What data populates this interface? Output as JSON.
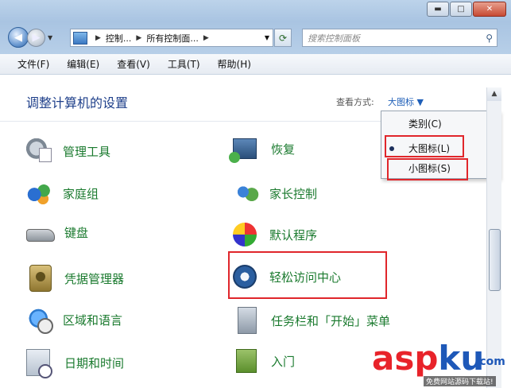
{
  "window": {
    "caption": {
      "minimize": "▬",
      "maximize": "□",
      "close": "✕"
    }
  },
  "nav": {
    "back": "◀",
    "forward": "▶",
    "dropdown": "▼"
  },
  "address": {
    "crumbs": [
      "控制...",
      "所有控制面..."
    ],
    "separator": "▶",
    "dropdown": "▼",
    "refresh": "⟳"
  },
  "search": {
    "placeholder": "搜索控制面板",
    "icon": "search-icon"
  },
  "menu": [
    "文件(F)",
    "编辑(E)",
    "查看(V)",
    "工具(T)",
    "帮助(H)"
  ],
  "content": {
    "heading": "调整计算机的设置",
    "view_by_label": "查看方式:",
    "view_by_value": "大图标 ▼"
  },
  "items_left": [
    {
      "label": "管理工具",
      "icon": "admin-tools-icon"
    },
    {
      "label": "家庭组",
      "icon": "homegroup-icon"
    },
    {
      "label": "键盘",
      "icon": "keyboard-icon"
    },
    {
      "label": "凭据管理器",
      "icon": "credential-manager-icon"
    },
    {
      "label": "区域和语言",
      "icon": "region-language-icon"
    },
    {
      "label": "日期和时间",
      "icon": "date-time-icon"
    }
  ],
  "items_right": [
    {
      "label": "恢复",
      "icon": "recovery-icon"
    },
    {
      "label": "家长控制",
      "icon": "parental-controls-icon"
    },
    {
      "label": "默认程序",
      "icon": "default-programs-icon"
    },
    {
      "label": "轻松访问中心",
      "icon": "ease-of-access-icon"
    },
    {
      "label": "任务栏和「开始」菜单",
      "icon": "taskbar-start-menu-icon"
    },
    {
      "label": "入门",
      "icon": "getting-started-icon"
    }
  ],
  "dropdown": {
    "options": [
      "类别(C)",
      "大图标(L)",
      "小图标(S)"
    ],
    "selected": "大图标(L)"
  },
  "scrollbar": {
    "up": "▲"
  },
  "watermark": {
    "brand_a": "asp",
    "brand_b": "ku",
    "domain": ".com",
    "tagline": "免费网站源码下载站!"
  },
  "colors": {
    "link_green": "#1a7a2e",
    "heading_blue": "#1e3f8a",
    "highlight_red": "#e0262b"
  }
}
